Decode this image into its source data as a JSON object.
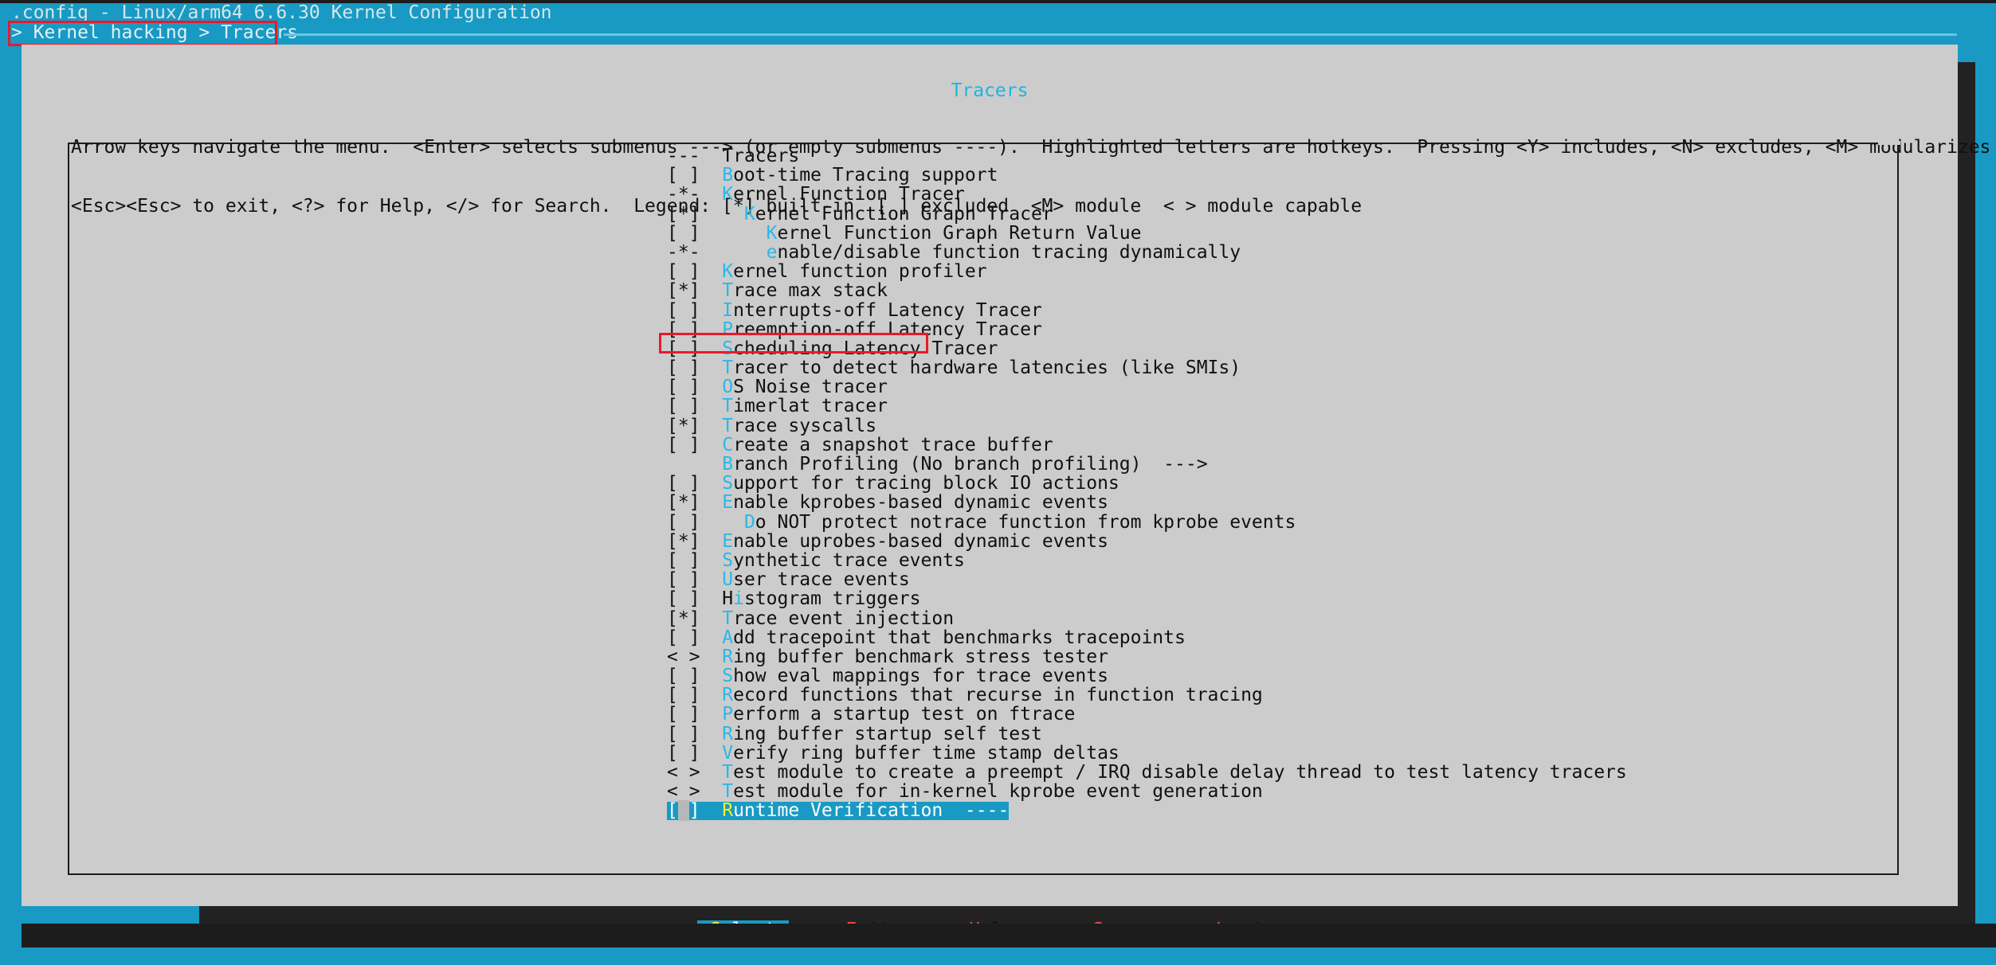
{
  "window": {
    "title": ".config - Linux/arm64 6.6.30 Kernel Configuration",
    "breadcrumb": "> Kernel hacking > Tracers",
    "menu_title": "Tracers"
  },
  "help": {
    "line1": "Arrow keys navigate the menu.  <Enter> selects submenus ---> (or empty submenus ----).  Highlighted letters are hotkeys.  Pressing <Y> includes, <N> excludes, <M> modularizes features.  Press",
    "line2": "<Esc><Esc> to exit, <?> for Help, </> for Search.  Legend: [*] built-in  [ ] excluded  <M> module  < > module capable"
  },
  "menu": {
    "items": [
      {
        "mark": "---",
        "indent": 0,
        "hotkey": "",
        "label": "Tracers",
        "type": "header",
        "selected": false
      },
      {
        "mark": "[ ]",
        "indent": 0,
        "hotkey": "B",
        "label": "oot-time Tracing support",
        "type": "bool",
        "selected": false
      },
      {
        "mark": "-*-",
        "indent": 0,
        "hotkey": "K",
        "label": "ernel Function Tracer",
        "type": "bool",
        "selected": false
      },
      {
        "mark": "[*]",
        "indent": 1,
        "hotkey": "K",
        "label": "ernel Function Graph Tracer",
        "type": "bool",
        "selected": false
      },
      {
        "mark": "[ ]",
        "indent": 2,
        "hotkey": "K",
        "label": "ernel Function Graph Return Value",
        "type": "bool",
        "selected": false
      },
      {
        "mark": "-*-",
        "indent": 2,
        "hotkey": "e",
        "label": "nable/disable function tracing dynamically",
        "type": "bool",
        "selected": false
      },
      {
        "mark": "[ ]",
        "indent": 0,
        "hotkey": "K",
        "label": "ernel function profiler",
        "type": "bool",
        "selected": false
      },
      {
        "mark": "[*]",
        "indent": 0,
        "hotkey": "T",
        "label": "race max stack",
        "type": "bool",
        "selected": false
      },
      {
        "mark": "[ ]",
        "indent": 0,
        "hotkey": "I",
        "label": "nterrupts-off Latency Tracer",
        "type": "bool",
        "selected": false
      },
      {
        "mark": "[ ]",
        "indent": 0,
        "hotkey": "P",
        "label": "reemption-off Latency Tracer",
        "type": "bool",
        "selected": false
      },
      {
        "mark": "[ ]",
        "indent": 0,
        "hotkey": "S",
        "label": "cheduling Latency Tracer",
        "type": "bool",
        "selected": false
      },
      {
        "mark": "[ ]",
        "indent": 0,
        "hotkey": "T",
        "label": "racer to detect hardware latencies (like SMIs)",
        "type": "bool",
        "selected": false
      },
      {
        "mark": "[ ]",
        "indent": 0,
        "hotkey": "O",
        "label": "S Noise tracer",
        "type": "bool",
        "selected": false
      },
      {
        "mark": "[ ]",
        "indent": 0,
        "hotkey": "T",
        "label": "imerlat tracer",
        "type": "bool",
        "selected": false
      },
      {
        "mark": "[*]",
        "indent": 0,
        "hotkey": "T",
        "label": "race syscalls",
        "type": "bool",
        "selected": false
      },
      {
        "mark": "[ ]",
        "indent": 0,
        "hotkey": "C",
        "label": "reate a snapshot trace buffer",
        "type": "bool",
        "selected": false
      },
      {
        "mark": "   ",
        "indent": 0,
        "hotkey": "B",
        "label": "ranch Profiling (No branch profiling)  --->",
        "type": "submenu",
        "selected": false
      },
      {
        "mark": "[ ]",
        "indent": 0,
        "hotkey": "S",
        "label": "upport for tracing block IO actions",
        "type": "bool",
        "selected": false
      },
      {
        "mark": "[*]",
        "indent": 0,
        "hotkey": "E",
        "label": "nable kprobes-based dynamic events",
        "type": "bool",
        "selected": false
      },
      {
        "mark": "[ ]",
        "indent": 1,
        "hotkey": "D",
        "label": "o NOT protect notrace function from kprobe events",
        "type": "bool",
        "selected": false
      },
      {
        "mark": "[*]",
        "indent": 0,
        "hotkey": "E",
        "label": "nable uprobes-based dynamic events",
        "type": "bool",
        "selected": false
      },
      {
        "mark": "[ ]",
        "indent": 0,
        "hotkey": "S",
        "label": "ynthetic trace events",
        "type": "bool",
        "selected": false
      },
      {
        "mark": "[ ]",
        "indent": 0,
        "hotkey": "U",
        "label": "ser trace events",
        "type": "bool",
        "selected": false
      },
      {
        "mark": "[ ]",
        "indent": 0,
        "hotkey": "",
        "label": "Histogram triggers",
        "type": "bool",
        "selected": false,
        "hk_index": 1
      },
      {
        "mark": "[*]",
        "indent": 0,
        "hotkey": "T",
        "label": "race event injection",
        "type": "bool",
        "selected": false
      },
      {
        "mark": "[ ]",
        "indent": 0,
        "hotkey": "A",
        "label": "dd tracepoint that benchmarks tracepoints",
        "type": "bool",
        "selected": false
      },
      {
        "mark": "< >",
        "indent": 0,
        "hotkey": "R",
        "label": "ing buffer benchmark stress tester",
        "type": "tristate",
        "selected": false
      },
      {
        "mark": "[ ]",
        "indent": 0,
        "hotkey": "S",
        "label": "how eval mappings for trace events",
        "type": "bool",
        "selected": false
      },
      {
        "mark": "[ ]",
        "indent": 0,
        "hotkey": "R",
        "label": "ecord functions that recurse in function tracing",
        "type": "bool",
        "selected": false
      },
      {
        "mark": "[ ]",
        "indent": 0,
        "hotkey": "P",
        "label": "erform a startup test on ftrace",
        "type": "bool",
        "selected": false
      },
      {
        "mark": "[ ]",
        "indent": 0,
        "hotkey": "R",
        "label": "ing buffer startup self test",
        "type": "bool",
        "selected": false
      },
      {
        "mark": "[ ]",
        "indent": 0,
        "hotkey": "V",
        "label": "erify ring buffer time stamp deltas",
        "type": "bool",
        "selected": false
      },
      {
        "mark": "< >",
        "indent": 0,
        "hotkey": "T",
        "label": "est module to create a preempt / IRQ disable delay thread to test latency tracers",
        "type": "tristate",
        "selected": false
      },
      {
        "mark": "< >",
        "indent": 0,
        "hotkey": "T",
        "label": "est module for in-kernel kprobe event generation",
        "type": "tristate",
        "selected": false
      },
      {
        "mark": "[ ]",
        "indent": 0,
        "hotkey": "R",
        "label": "untime Verification  ----",
        "type": "submenu-empty",
        "selected": true
      }
    ]
  },
  "buttons": [
    {
      "open": "<",
      "hotkey": "S",
      "rest": "elect",
      "close": ">",
      "active": true,
      "name": "select"
    },
    {
      "open": "< ",
      "hotkey": "E",
      "rest": "xit",
      "close": " >",
      "active": false,
      "name": "exit"
    },
    {
      "open": "< ",
      "hotkey": "H",
      "rest": "elp",
      "close": " >",
      "active": false,
      "name": "help"
    },
    {
      "open": "< ",
      "hotkey": "S",
      "rest": "ave",
      "close": " >",
      "active": false,
      "name": "save"
    },
    {
      "open": "< ",
      "hotkey": "L",
      "rest": "oad",
      "close": " >",
      "active": false,
      "name": "load"
    }
  ],
  "annotations": {
    "breadcrumb_box_color": "#e8192c",
    "trace_max_stack_box_color": "#e8192c"
  },
  "colors": {
    "terminal_bg": "#189ac4",
    "pane_bg": "#cccccc",
    "hotkey": "#2bb8e8",
    "selected_bg": "#189ac4",
    "selected_hotkey": "#f2ef21",
    "button_hotkey": "#ef4b4b"
  }
}
